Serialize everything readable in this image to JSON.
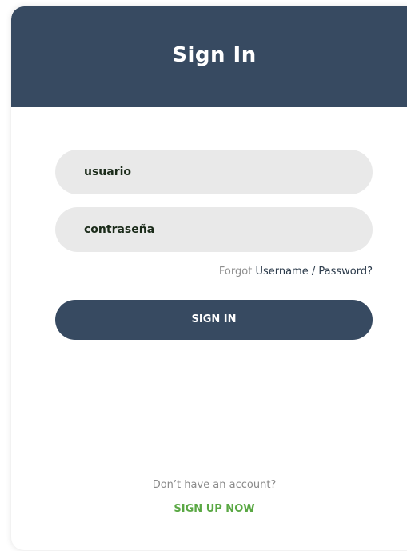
{
  "header": {
    "title": "Sign In"
  },
  "form": {
    "username_value": "usuario",
    "password_value": "contraseña",
    "forgot_prefix": "Forgot",
    "forgot_link": "Username / Password?",
    "submit_label": "SIGN IN"
  },
  "footer": {
    "no_account_text": "Don’t have an account?",
    "signup_label": "SIGN UP NOW"
  },
  "colors": {
    "header_bg": "#374a61",
    "button_bg": "#374a61",
    "field_bg": "#e9e9e9",
    "signup_green": "#5aa844"
  }
}
